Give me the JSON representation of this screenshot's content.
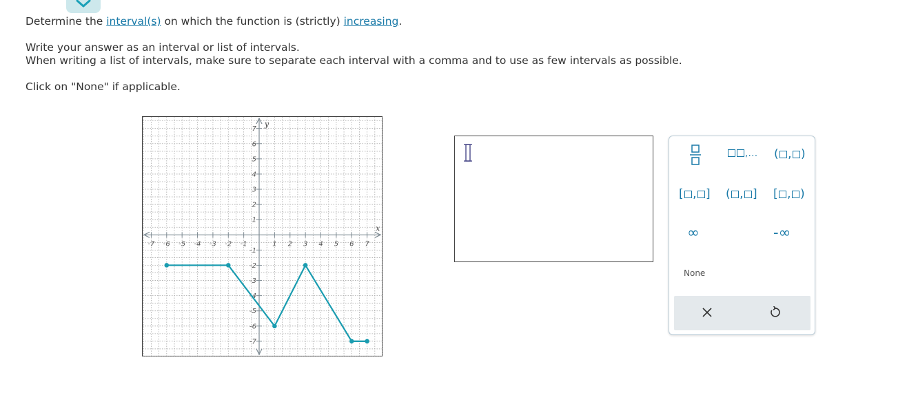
{
  "header": {
    "collapse_icon": "chevron-down-icon"
  },
  "question": {
    "line1": {
      "part1": "Determine the ",
      "link1": "interval(s)",
      "part2": " on which the function is (strictly) ",
      "link2": "increasing",
      "part3": "."
    },
    "line2": "Write your answer as an interval or list of intervals.",
    "line3": "When writing a list of intervals, make sure to separate each interval with a comma and to use as few intervals as possible.",
    "line4": "Click on \"None\" if applicable."
  },
  "graph": {
    "x_label": "x",
    "y_label": "y",
    "x_ticks": [
      "-7",
      "-6",
      "-5",
      "-4",
      "-3",
      "-2",
      "-1",
      "1",
      "2",
      "3",
      "4",
      "5",
      "6",
      "7"
    ],
    "y_ticks": [
      "7",
      "6",
      "5",
      "4",
      "3",
      "2",
      "1",
      "-1",
      "-2",
      "-3",
      "-4",
      "-5",
      "-6",
      "-7"
    ],
    "x_tick_values": [
      -7,
      -6,
      -5,
      -4,
      -3,
      -2,
      -1,
      1,
      2,
      3,
      4,
      5,
      6,
      7
    ],
    "y_tick_values": [
      7,
      6,
      5,
      4,
      3,
      2,
      1,
      -1,
      -2,
      -3,
      -4,
      -5,
      -6,
      -7
    ],
    "xlim": [
      -7.6,
      8
    ],
    "ylim": [
      -8,
      7.8
    ],
    "curve": [
      [
        -6,
        -2
      ],
      [
        -2,
        -2
      ],
      [
        1,
        -6
      ],
      [
        3,
        -2
      ],
      [
        6,
        -7
      ],
      [
        7,
        -7
      ]
    ],
    "colors": {
      "curve": "#1a9cb0",
      "grid": "#a8a8a8",
      "axis": "#7f8c94"
    }
  },
  "answer": {
    "value": "",
    "cursor_icon": "text-cursor-icon"
  },
  "palette": {
    "fraction_icon": "fraction-icon",
    "list_ellipsis": ",...",
    "interval_comma": ",",
    "infinity": "∞",
    "neg_infinity": "-∞",
    "none_label": "None",
    "clear_icon": "close-icon",
    "undo_icon": "undo-icon"
  }
}
